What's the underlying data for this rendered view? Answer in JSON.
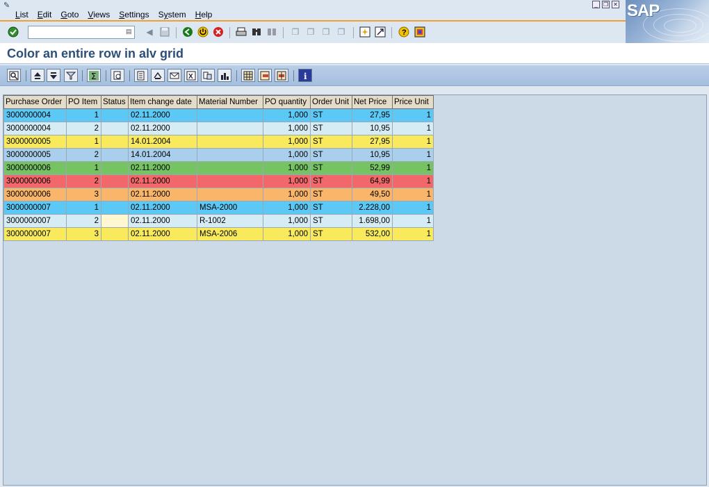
{
  "menu": {
    "items": [
      {
        "label": "List",
        "key": "L"
      },
      {
        "label": "Edit",
        "key": "E"
      },
      {
        "label": "Goto",
        "key": "G"
      },
      {
        "label": "Views",
        "key": "V"
      },
      {
        "label": "Settings",
        "key": "S"
      },
      {
        "label": "System",
        "key": "y"
      },
      {
        "label": "Help",
        "key": "H"
      }
    ]
  },
  "brand": {
    "logo_text": "SAP"
  },
  "command_field": {
    "value": ""
  },
  "page": {
    "title": "Color an entire row in alv grid"
  },
  "grid": {
    "columns": [
      "Purchase Order",
      "PO Item",
      "Status",
      "Item change date",
      "Material Number",
      "PO quantity",
      "Order Unit",
      "Net Price",
      "Price Unit"
    ],
    "rows": [
      {
        "color": "#5bc8f5",
        "cells": [
          "3000000004",
          "1",
          "",
          "02.11.2000",
          "",
          "1,000",
          "ST",
          "27,95",
          "1"
        ]
      },
      {
        "color": "#d6ecf4",
        "cells": [
          "3000000004",
          "2",
          "",
          "02.11.2000",
          "",
          "1,000",
          "ST",
          "10,95",
          "1"
        ]
      },
      {
        "color": "#f8ea5c",
        "cells": [
          "3000000005",
          "1",
          "",
          "14.01.2004",
          "",
          "1,000",
          "ST",
          "27,95",
          "1"
        ]
      },
      {
        "color": "#a9cfec",
        "cells": [
          "3000000005",
          "2",
          "",
          "14.01.2004",
          "",
          "1,000",
          "ST",
          "10,95",
          "1"
        ]
      },
      {
        "color": "#76c363",
        "cells": [
          "3000000006",
          "1",
          "",
          "02.11.2000",
          "",
          "1,000",
          "ST",
          "52,99",
          "1"
        ]
      },
      {
        "color": "#f2676a",
        "cells": [
          "3000000006",
          "2",
          "",
          "02.11.2000",
          "",
          "1,000",
          "ST",
          "64,99",
          "1"
        ]
      },
      {
        "color": "#f9b56a",
        "cells": [
          "3000000006",
          "3",
          "",
          "02.11.2000",
          "",
          "1,000",
          "ST",
          "49,50",
          "1"
        ]
      },
      {
        "color": "#5bc8f5",
        "cells": [
          "3000000007",
          "1",
          "",
          "02.11.2000",
          "MSA-2000",
          "1,000",
          "ST",
          "2.228,00",
          "1"
        ]
      },
      {
        "color": "#d6ecf4",
        "cells": [
          "3000000007",
          "2",
          "",
          "02.11.2000",
          "R-1002",
          "1,000",
          "ST",
          "1.698,00",
          "1"
        ]
      },
      {
        "color": "#f8ea5c",
        "cells": [
          "3000000007",
          "3",
          "",
          "02.11.2000",
          "MSA-2006",
          "1,000",
          "ST",
          "532,00",
          "1"
        ]
      }
    ]
  }
}
